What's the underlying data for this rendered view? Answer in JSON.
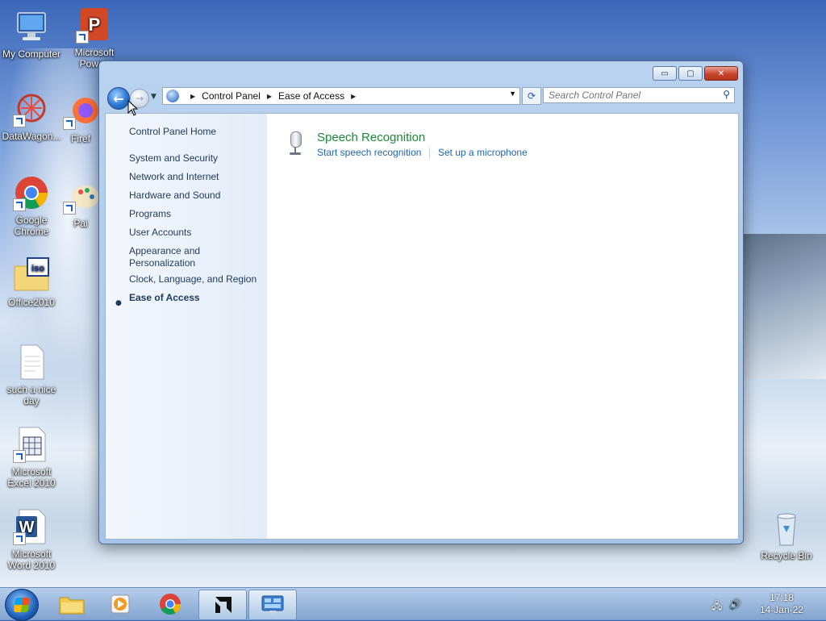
{
  "desktop": {
    "icons": [
      {
        "id": "my-computer",
        "label": "My Computer"
      },
      {
        "id": "powerpoint",
        "label": "Microsoft Powerl"
      },
      {
        "id": "datawagon",
        "label": "DataWagon..."
      },
      {
        "id": "firefox",
        "label": "Firef"
      },
      {
        "id": "chrome",
        "label": "Google Chrome"
      },
      {
        "id": "paint",
        "label": "Pai"
      },
      {
        "id": "office2010",
        "label": "Office2010"
      },
      {
        "id": "such-a-nice-day",
        "label": "such a nice day"
      },
      {
        "id": "excel",
        "label": "Microsoft Excel 2010"
      },
      {
        "id": "word",
        "label": "Microsoft Word 2010"
      },
      {
        "id": "recycle-bin",
        "label": "Recycle Bin"
      }
    ]
  },
  "window": {
    "title_buttons": {
      "minimize": "▭",
      "maximize": "▢",
      "close": "✕"
    },
    "address": {
      "crumbs": [
        "Control Panel",
        "Ease of Access"
      ]
    },
    "search": {
      "placeholder": "Search Control Panel"
    },
    "left_nav": {
      "home": "Control Panel Home",
      "items": [
        "System and Security",
        "Network and Internet",
        "Hardware and Sound",
        "Programs",
        "User Accounts",
        "Appearance and Personalization",
        "Clock, Language, and Region",
        "Ease of Access"
      ],
      "active_item": "Ease of Access"
    },
    "main": {
      "category_title": "Speech Recognition",
      "links": [
        "Start speech recognition",
        "Set up a microphone"
      ]
    }
  },
  "taskbar": {
    "clock_time": "17:18",
    "clock_date": "14-Jan-22"
  },
  "colors": {
    "link_blue": "#1e67b0",
    "category_green": "#1b8a3a",
    "nav_text": "#1e395b"
  }
}
